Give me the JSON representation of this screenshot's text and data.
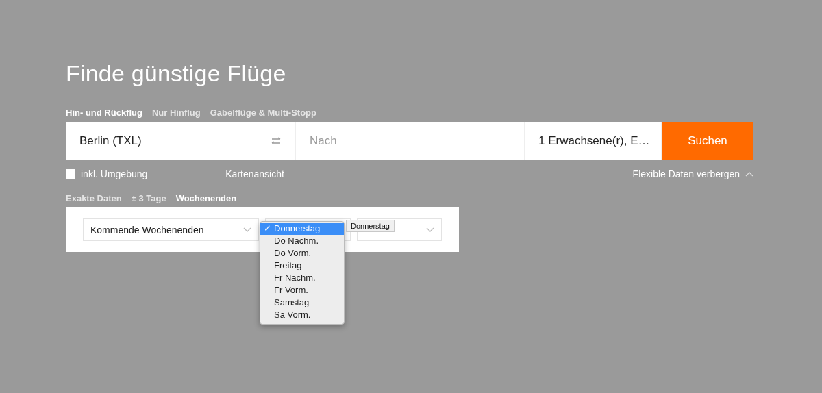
{
  "title": "Finde günstige Flüge",
  "trip_tabs": [
    {
      "label": "Hin- und Rückflug",
      "selected": true
    },
    {
      "label": "Nur Hinflug",
      "selected": false
    },
    {
      "label": "Gabelflüge & Multi-Stopp",
      "selected": false
    }
  ],
  "search": {
    "origin": "Berlin (TXL)",
    "destination_placeholder": "Nach",
    "passengers": "1 Erwachsene(r), E…",
    "button": "Suchen"
  },
  "options": {
    "nearby": {
      "label": "inkl. Umgebung",
      "checked": false
    },
    "map_link": "Kartenansicht",
    "flex_toggle": "Flexible Daten verbergen"
  },
  "date_tabs": [
    {
      "label": "Exakte Daten",
      "selected": false
    },
    {
      "label": "± 3 Tage",
      "selected": false
    },
    {
      "label": "Wochenenden",
      "selected": true
    }
  ],
  "weekend_select": "Kommende Wochenenden",
  "day_menu": [
    {
      "label": "Donnerstag",
      "selected": true
    },
    {
      "label": "Do Nachm.",
      "selected": false
    },
    {
      "label": "Do Vorm.",
      "selected": false
    },
    {
      "label": "Freitag",
      "selected": false
    },
    {
      "label": "Fr Nachm.",
      "selected": false
    },
    {
      "label": "Fr Vorm.",
      "selected": false
    },
    {
      "label": "Samstag",
      "selected": false
    },
    {
      "label": "Sa Vorm.",
      "selected": false
    }
  ],
  "selected_mark": "✓",
  "tooltip": "Donnerstag"
}
